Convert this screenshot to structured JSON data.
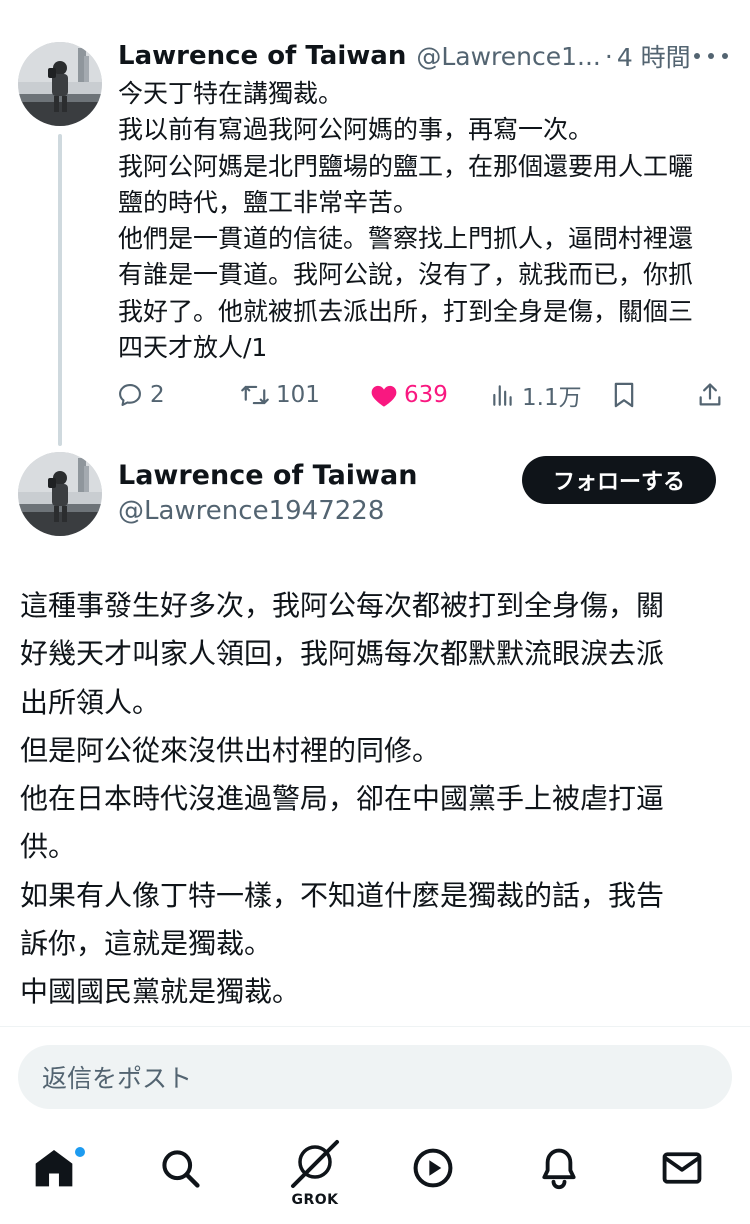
{
  "parent_tweet": {
    "display_name": "Lawrence of Taiwan",
    "handle_truncated": "@Lawrence1...",
    "separator": "·",
    "time": "4 時間",
    "lines": [
      "今天丁特在講獨裁。",
      "我以前有寫過我阿公阿媽的事，再寫一次。",
      "我阿公阿媽是北門鹽場的鹽工，在那個還要用人工曬",
      "鹽的時代，鹽工非常辛苦。",
      "他們是一貫道的信徒。警察找上門抓人，逼問村裡還",
      "有誰是一貫道。我阿公說，沒有了，就我而已，你抓",
      "我好了。他就被抓去派出所，打到全身是傷，關個三",
      "四天才放人/1"
    ],
    "actions": {
      "replies": "2",
      "reposts": "101",
      "likes": "639",
      "views": "1.1万"
    },
    "liked": true,
    "like_color": "#f91880"
  },
  "main_tweet": {
    "display_name": "Lawrence of Taiwan",
    "handle": "@Lawrence1947228",
    "follow_label": "フォローする",
    "lines": [
      "這種事發生好多次，我阿公每次都被打到全身傷，關",
      "好幾天才叫家人領回，我阿媽每次都默默流眼淚去派",
      "出所領人。",
      "但是阿公從來沒供出村裡的同修。",
      "他在日本時代沒進過警局，卻在中國黨手上被虐打逼",
      "供。",
      "如果有人像丁特一樣，不知道什麼是獨裁的話，我告",
      "訴你，這就是獨裁。",
      "中國國民黨就是獨裁。"
    ]
  },
  "reply": {
    "placeholder": "返信をポスト"
  },
  "bottom_nav": {
    "items": [
      "home-icon",
      "search-icon",
      "grok-icon",
      "video-icon",
      "notifications-icon",
      "messages-icon"
    ],
    "grok_label": "GROK",
    "active": "home",
    "unread_dot_color": "#1d9bf0"
  },
  "colors": {
    "text": "#0f1419",
    "secondary": "#536471",
    "like": "#f91880",
    "accent": "#1d9bf0"
  }
}
